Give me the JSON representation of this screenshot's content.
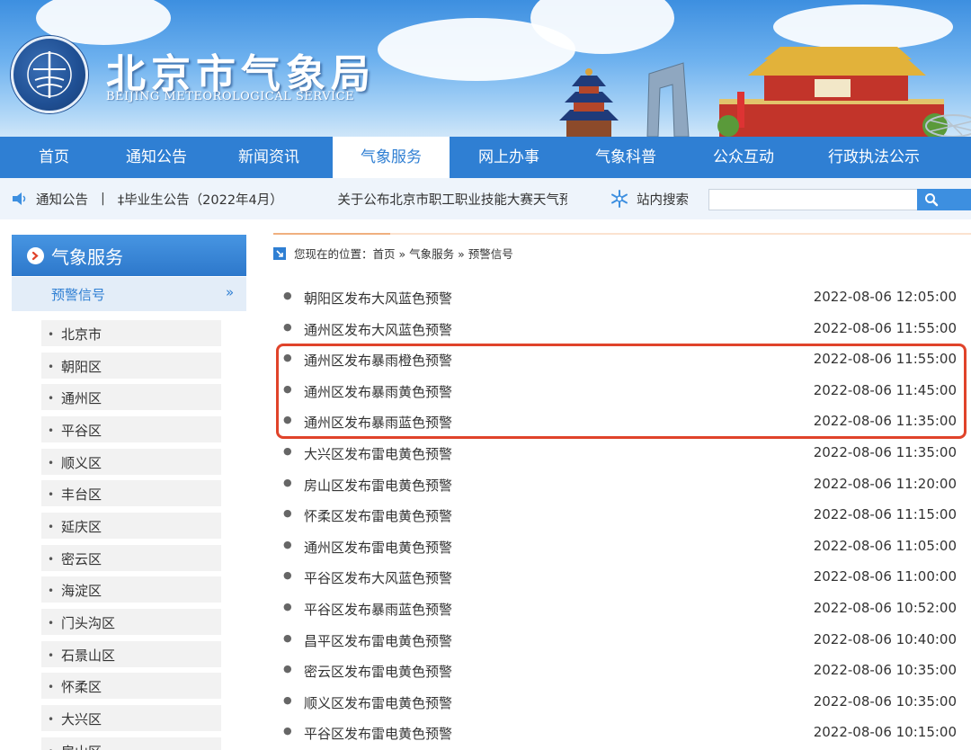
{
  "header": {
    "site_title": "北京市气象局",
    "site_subtitle": "BEIJING METEOROLOGICAL SERVICE"
  },
  "nav": {
    "items": [
      {
        "label": "首页",
        "active": false
      },
      {
        "label": "通知公告",
        "active": false
      },
      {
        "label": "新闻资讯",
        "active": false
      },
      {
        "label": "气象服务",
        "active": true
      },
      {
        "label": "网上办事",
        "active": false
      },
      {
        "label": "气象科普",
        "active": false
      },
      {
        "label": "公众互动",
        "active": false
      },
      {
        "label": "行政执法公示",
        "active": false
      }
    ]
  },
  "notice": {
    "label": "通知公告",
    "separator": "|",
    "items": [
      "‡毕业生公告（2022年4月）",
      "关于公布北京市职工职业技能大赛天气预"
    ],
    "search_label": "站内搜索",
    "search_placeholder": ""
  },
  "sidebar": {
    "title": "气象服务",
    "current": "预警信号",
    "current_arrow": "»",
    "items": [
      {
        "label": "北京市"
      },
      {
        "label": "朝阳区"
      },
      {
        "label": "通州区"
      },
      {
        "label": "平谷区"
      },
      {
        "label": "顺义区"
      },
      {
        "label": "丰台区"
      },
      {
        "label": "延庆区"
      },
      {
        "label": "密云区"
      },
      {
        "label": "海淀区"
      },
      {
        "label": "门头沟区"
      },
      {
        "label": "石景山区"
      },
      {
        "label": "怀柔区"
      },
      {
        "label": "大兴区"
      },
      {
        "label": "房山区"
      }
    ]
  },
  "breadcrumb": {
    "text": "您现在的位置：首页 » 气象服务 » 预警信号"
  },
  "warnings": {
    "items": [
      {
        "title": "朝阳区发布大风蓝色预警",
        "time": "2022-08-06 12:05:00"
      },
      {
        "title": "通州区发布大风蓝色预警",
        "time": "2022-08-06 11:55:00"
      },
      {
        "title": "通州区发布暴雨橙色预警",
        "time": "2022-08-06 11:55:00"
      },
      {
        "title": "通州区发布暴雨黄色预警",
        "time": "2022-08-06 11:45:00"
      },
      {
        "title": "通州区发布暴雨蓝色预警",
        "time": "2022-08-06 11:35:00"
      },
      {
        "title": "大兴区发布雷电黄色预警",
        "time": "2022-08-06 11:35:00"
      },
      {
        "title": "房山区发布雷电黄色预警",
        "time": "2022-08-06 11:20:00"
      },
      {
        "title": "怀柔区发布雷电黄色预警",
        "time": "2022-08-06 11:15:00"
      },
      {
        "title": "通州区发布雷电黄色预警",
        "time": "2022-08-06 11:05:00"
      },
      {
        "title": "平谷区发布大风蓝色预警",
        "time": "2022-08-06 11:00:00"
      },
      {
        "title": "平谷区发布暴雨蓝色预警",
        "time": "2022-08-06 10:52:00"
      },
      {
        "title": "昌平区发布雷电黄色预警",
        "time": "2022-08-06 10:40:00"
      },
      {
        "title": "密云区发布雷电黄色预警",
        "time": "2022-08-06 10:35:00"
      },
      {
        "title": "顺义区发布雷电黄色预警",
        "time": "2022-08-06 10:35:00"
      },
      {
        "title": "平谷区发布雷电黄色预警",
        "time": "2022-08-06 10:15:00"
      }
    ],
    "highlighted_rows": [
      3,
      4,
      5
    ],
    "highlight_color": "#e0432a"
  },
  "colors": {
    "nav_bg": "#2f7fd3",
    "accent_blue": "#2f7fd3",
    "notice_bg": "#eef4fb"
  }
}
